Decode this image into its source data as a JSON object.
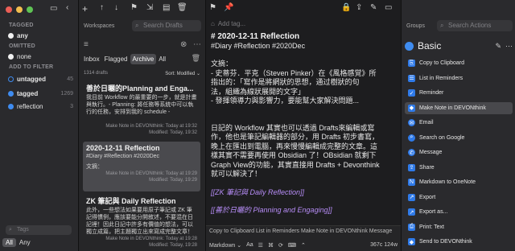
{
  "tags_sidebar": {
    "tagged_header": "TAGGED",
    "tagged_any": "any",
    "omitted_header": "OMITTED",
    "omitted_none": "none",
    "filter_header": "ADD TO FILTER",
    "filters": [
      {
        "label": "untagged",
        "count": "45"
      },
      {
        "label": "tagged",
        "count": "1269"
      },
      {
        "label": "reflection",
        "count": "3"
      }
    ],
    "search_placeholder": "Tags",
    "seg_all": "All",
    "seg_any": "Any"
  },
  "toolbar": {
    "workspaces_label": "Workspaces",
    "search_drafts_placeholder": "Search Drafts",
    "add_tag_placeholder": "Add tag...",
    "groups_label": "Groups",
    "search_actions_placeholder": "Search Actions"
  },
  "list": {
    "tabs": [
      "Inbox",
      "Flagged",
      "Archive",
      "All"
    ],
    "active_tab": "Archive",
    "count": "1314 drafts",
    "sort": "Sort: Modified ⌄",
    "items": [
      {
        "title": "善於日曬的Planning and Enga...",
        "body": "我目前 Workflow 的最重要的一步，就是計畫與執行。- Planning: 將任務等系統中可以執行的任務，安排到我的 schedule -",
        "meta1": "Make Note in DEVONthink: Today at 19:32",
        "meta2": "Modified: Today, 19:32"
      },
      {
        "title": "2020-12-11 Reflection",
        "body": "#Diary #Reflection #2020Dec",
        "body2": "文摘：",
        "meta1": "Make Note in DEVONthink: Today at 19:29",
        "meta2": "Modified: Today, 19:29"
      },
      {
        "title": "ZK 筆記與 Daily Reflection",
        "body": "此外，一些想法如果要用原子筆記或 ZK 筆記得慣例，應該要能分開敘述，不要混在日記裡！因此日記中許多有價值的想法，可以獨立成篇，把主題獨立出來寫成完整文章！",
        "meta1": "Make Note in DEVONthink: Today at 19:28",
        "meta2": "Modified: Today, 19:28"
      }
    ]
  },
  "editor": {
    "lines": [
      {
        "kind": "h1",
        "text": "# 2020-12-11 Reflection"
      },
      {
        "kind": "text",
        "text": "#Diary #Reflection #2020Dec"
      },
      {
        "kind": "blank",
        "text": ""
      },
      {
        "kind": "text",
        "text": "文摘："
      },
      {
        "kind": "text",
        "text": "- 史蒂芬．平克（Steven Pinker）在《風格感覚》所"
      },
      {
        "kind": "text",
        "text": "  指出的：「寫作是將網狀的思想，通过樹狀的句"
      },
      {
        "kind": "text",
        "text": "  法，組織為線狀展開的文字」"
      },
      {
        "kind": "text",
        "text": "- 發揮領導力與影響力，要能幫大家解決問題..."
      },
      {
        "kind": "blank",
        "text": ""
      },
      {
        "kind": "blank",
        "text": ""
      },
      {
        "kind": "text",
        "text": "日記的 Workflow 其實也可以透過 Drafts來編輯或寫"
      },
      {
        "kind": "text",
        "text": "作，他也是筆記編輯器的部分，用 Drafts 初步書寫，"
      },
      {
        "kind": "text",
        "text": "晚上在匯出到電腦，再來慢慢編輯成完整的文章。這"
      },
      {
        "kind": "text",
        "text": "樣其實不需要再使用 Obsidian 了！OBsidian 就剩下"
      },
      {
        "kind": "text",
        "text": "Graph View的功能，其實直接用 Drafts + Devonthink"
      },
      {
        "kind": "text",
        "text": "就可以解決了！"
      },
      {
        "kind": "blank",
        "text": ""
      },
      {
        "kind": "link",
        "text": "[[ZK 筆記與 Daily Reflection]]"
      },
      {
        "kind": "blank",
        "text": ""
      },
      {
        "kind": "link",
        "text": "[[善於日曬的 Planning and Engaging]]"
      }
    ],
    "bottom_row1": "Copy to Clipboard   List in Reminders   Make Note in DEVONthink   Message",
    "bottom_mode": "Markdown ⌄",
    "bottom_aa": "Aa",
    "bottom_stats": "367c 124w"
  },
  "actions": {
    "group_title": "Basic",
    "items": [
      {
        "label": "Copy to Clipboard",
        "icon": "clipboard-icon"
      },
      {
        "label": "List in Reminders",
        "icon": "list-icon"
      },
      {
        "label": "Reminder",
        "icon": "reminder-icon"
      },
      {
        "label": "Make Note in DEVONthink",
        "icon": "devonthink-icon"
      },
      {
        "label": "Email",
        "icon": "mail-icon"
      },
      {
        "label": "Search on Google",
        "icon": "search-icon"
      },
      {
        "label": "Message",
        "icon": "message-icon"
      },
      {
        "label": "Share",
        "icon": "share-icon"
      },
      {
        "label": "Markdown to OneNote",
        "icon": "onenote-icon"
      },
      {
        "label": "Export",
        "icon": "export-icon"
      },
      {
        "label": "Export as...",
        "icon": "export-icon"
      },
      {
        "label": "Print: Text",
        "icon": "print-icon"
      },
      {
        "label": "Send to DEVONthink",
        "icon": "devonthink-icon"
      }
    ],
    "highlighted": "Make Note in DEVONthink"
  },
  "colors": {
    "accent": "#3f8cf0",
    "link": "#b78df7"
  }
}
